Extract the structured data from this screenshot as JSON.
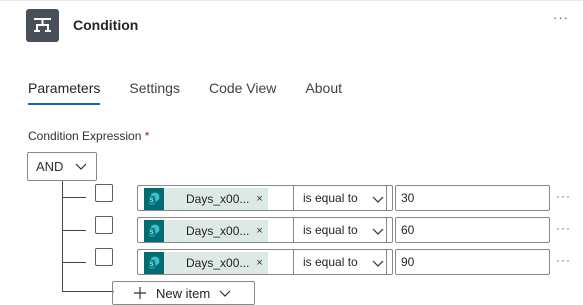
{
  "header": {
    "title": "Condition",
    "more_label": "···"
  },
  "tabs": [
    {
      "label": "Parameters",
      "active": true
    },
    {
      "label": "Settings",
      "active": false
    },
    {
      "label": "Code View",
      "active": false
    },
    {
      "label": "About",
      "active": false
    }
  ],
  "expression": {
    "label": "Condition Expression",
    "required_mark": "*",
    "group_operator": "AND"
  },
  "rows": [
    {
      "token": "Days_x00...",
      "token_close": "×",
      "operator": "is equal to",
      "value": "30",
      "more": "···"
    },
    {
      "token": "Days_x00...",
      "token_close": "×",
      "operator": "is equal to",
      "value": "60",
      "more": "···"
    },
    {
      "token": "Days_x00...",
      "token_close": "×",
      "operator": "is equal to",
      "value": "90",
      "more": "···"
    }
  ],
  "new_item": {
    "label": "New item"
  },
  "colors": {
    "accent": "#0f6cbd",
    "action_icon_bg": "#484f58",
    "sharepoint_icon_bg": "#036c70",
    "token_bg": "#dde9e5"
  }
}
